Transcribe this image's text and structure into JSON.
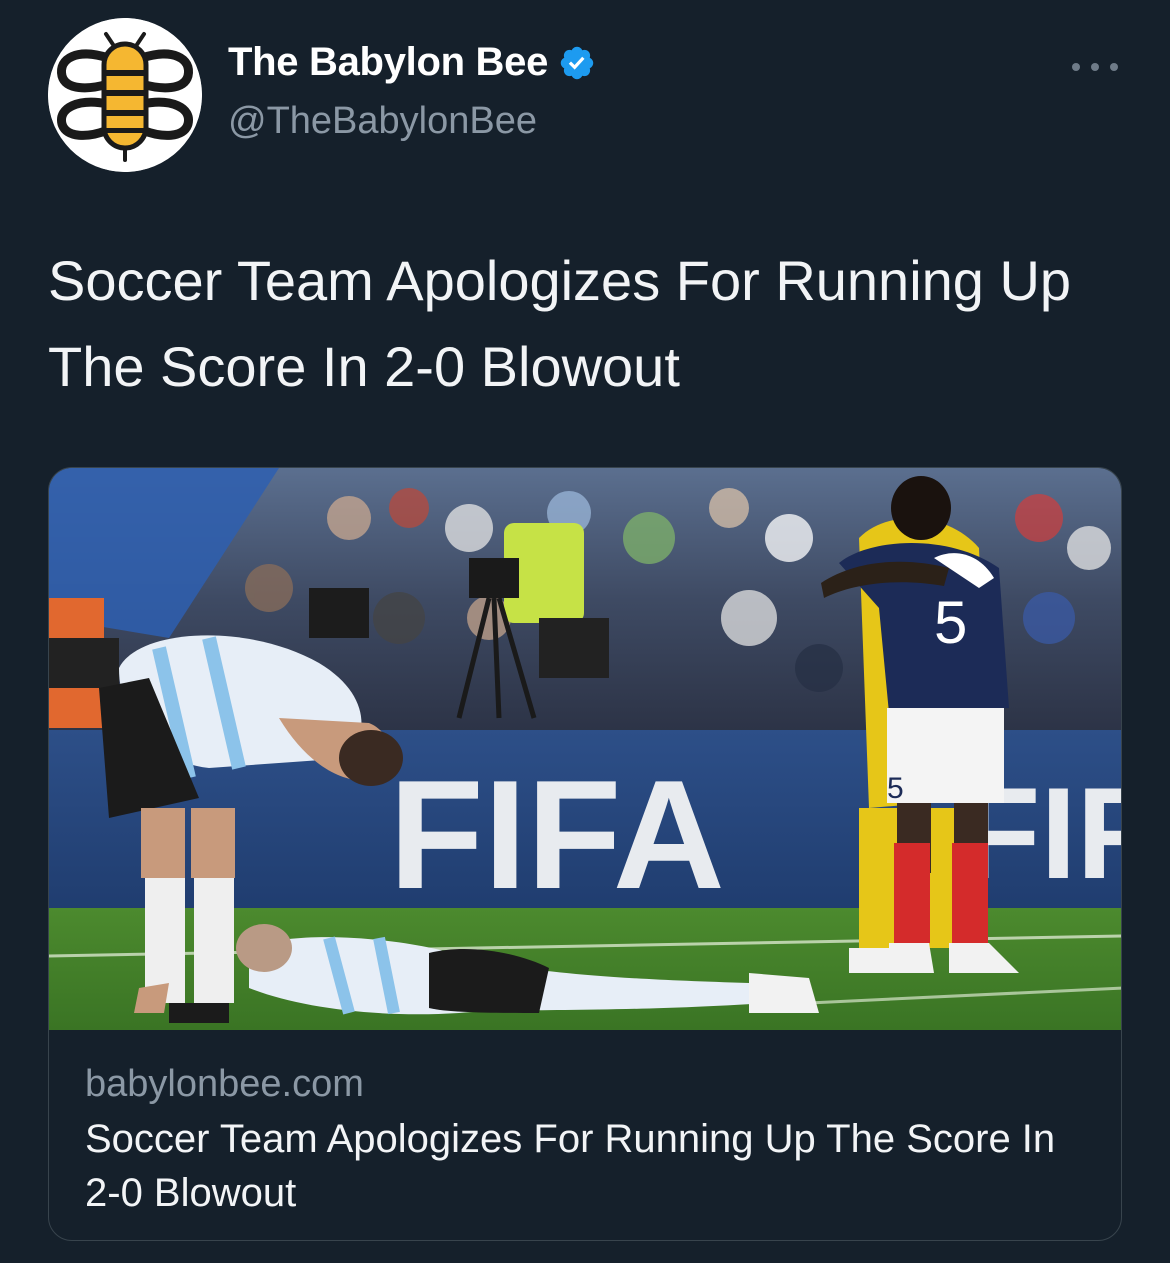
{
  "author": {
    "display_name": "The Babylon Bee",
    "handle": "@TheBabylonBee",
    "verified": true,
    "avatar_icon": "bee-logo-icon",
    "verified_icon": "verified-badge-icon"
  },
  "more_icon": "more-options-icon",
  "tweet": {
    "text": "Soccer Team Apologizes For Running Up The Score In 2-0 Blowout"
  },
  "card": {
    "domain": "babylonbee.com",
    "title": "Soccer Team Apologizes For Running Up The Score In 2-0 Blowout",
    "image": {
      "board_text": "FIFA",
      "board_text_2": "FIFA",
      "jersey_number": "5",
      "shorts_number": "5"
    }
  },
  "colors": {
    "background": "#15202b",
    "secondary_text": "#8b98a5",
    "border": "#38444d",
    "verified_blue": "#1d9bf0",
    "bee_yellow": "#f5b731"
  }
}
